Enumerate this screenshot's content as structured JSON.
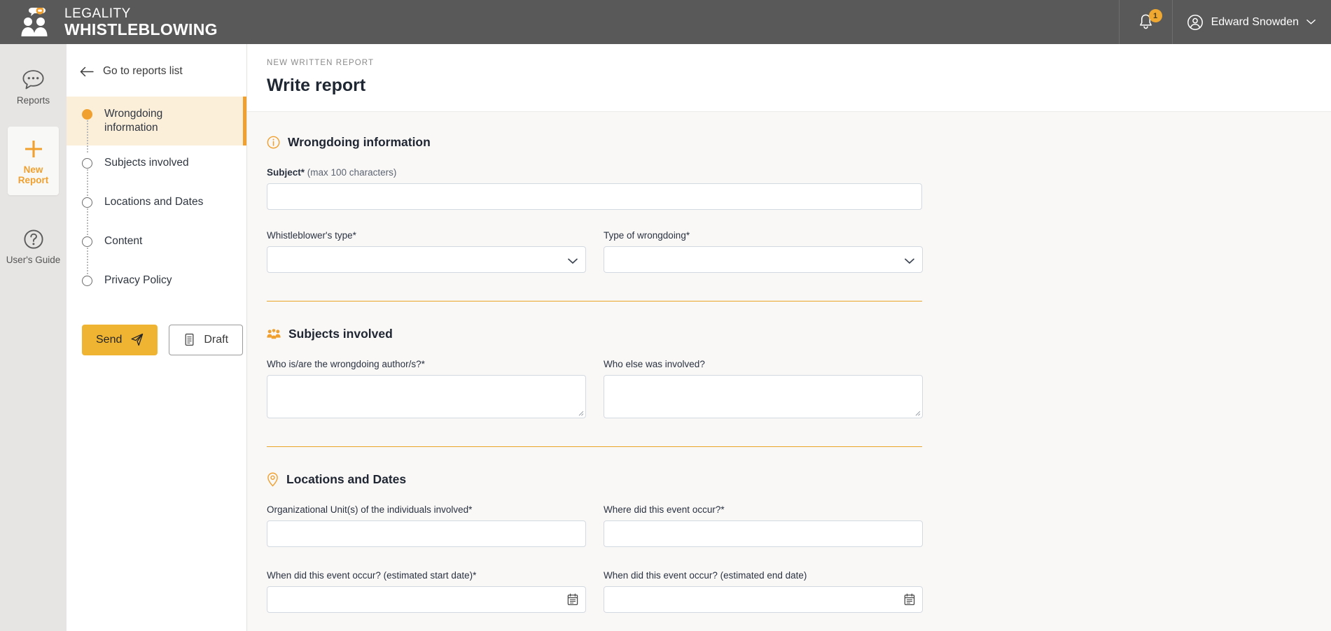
{
  "brand": {
    "line1": "LEGALITY",
    "line2": "WHISTLEBLOWING",
    "accent_color": "#F0A02E",
    "topbar_color": "#595959"
  },
  "topbar": {
    "notifications_icon": "bell-icon",
    "notifications_count": "1",
    "user_icon": "user-circle-icon",
    "user_name": "Edward Snowden",
    "user_chevron": "chevron-down-icon"
  },
  "rail": {
    "items": [
      {
        "label": "Reports",
        "icon": "chat-bubble-icon",
        "active": false
      },
      {
        "label": "New Report",
        "icon": "plus-icon",
        "active": true
      },
      {
        "label": "User's Guide",
        "icon": "question-circle-icon",
        "active": false
      }
    ]
  },
  "steppanel": {
    "back_label": "Go to reports list",
    "back_icon": "arrow-left-icon",
    "steps": [
      {
        "label": "Wrongdoing information",
        "active": true
      },
      {
        "label": "Subjects involved",
        "active": false
      },
      {
        "label": "Locations and Dates",
        "active": false
      },
      {
        "label": "Content",
        "active": false
      },
      {
        "label": "Privacy Policy",
        "active": false
      }
    ],
    "send_label": "Send",
    "send_icon": "paper-plane-icon",
    "draft_label": "Draft",
    "draft_icon": "document-icon"
  },
  "main": {
    "eyebrow": "NEW WRITTEN REPORT",
    "title": "Write report"
  },
  "sections": {
    "wrongdoing": {
      "title": "Wrongdoing information",
      "icon": "info-circle-icon",
      "subject_label": "Subject*",
      "subject_hint": "(max 100 characters)",
      "subject_value": "",
      "subject_placeholder": "",
      "whistleblower_label": "Whistleblower's type*",
      "whistleblower_value": "",
      "wrongdoing_type_label": "Type of wrongdoing*",
      "wrongdoing_type_value": ""
    },
    "subjects": {
      "title": "Subjects involved",
      "icon": "users-group-icon",
      "authors_label": "Who is/are the wrongdoing author/s?*",
      "authors_value": "",
      "others_label": "Who else was involved?",
      "others_value": ""
    },
    "locations": {
      "title": "Locations and Dates",
      "icon": "map-pin-icon",
      "org_unit_label": "Organizational Unit(s) of the individuals involved*",
      "org_unit_value": "",
      "where_label": "Where did this event occur?*",
      "where_value": "",
      "start_date_label": "When did this event occur? (estimated start date)*",
      "start_date_value": "",
      "end_date_label": "When did this event occur? (estimated end date)",
      "end_date_value": "",
      "calendar_icon": "calendar-icon"
    }
  }
}
